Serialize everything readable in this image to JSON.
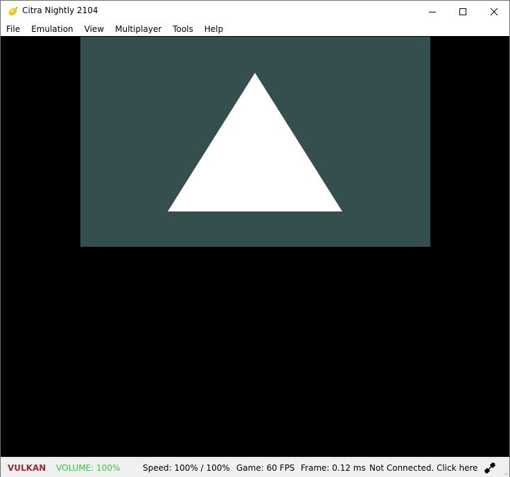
{
  "window": {
    "title": "Citra Nightly 2104",
    "app_icon": "citra-lemon-icon",
    "controls": {
      "minimize_icon": "minimize-icon",
      "maximize_icon": "maximize-icon",
      "close_icon": "close-icon"
    }
  },
  "menu": {
    "items": [
      "File",
      "Emulation",
      "View",
      "Multiplayer",
      "Tools",
      "Help"
    ]
  },
  "render": {
    "top_screen_color": "#344f4d",
    "background_color": "#000000",
    "shape": "white-triangle"
  },
  "status": {
    "api": "VULKAN",
    "api_color": "#9a2a31",
    "volume": "VOLUME: 100%",
    "volume_color": "#2ecc2e",
    "speed": "Speed: 100% / 100%",
    "game": "Game: 60 FPS",
    "frame": "Frame: 0.12 ms",
    "network": "Not Connected. Click here t",
    "network_icon": "network-disconnected-icon"
  }
}
